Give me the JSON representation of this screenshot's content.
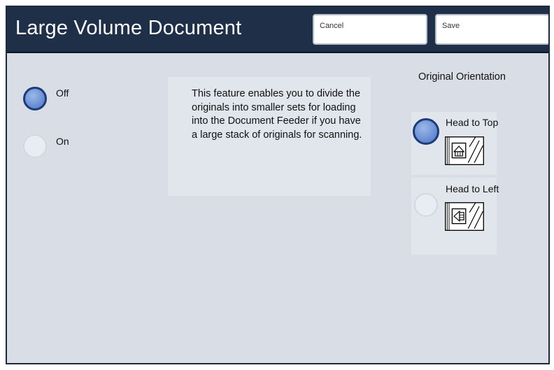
{
  "header": {
    "title": "Large Volume Document",
    "cancel_label": "Cancel",
    "save_label": "Save"
  },
  "options": [
    {
      "label": "Off",
      "selected": true
    },
    {
      "label": "On",
      "selected": false
    }
  ],
  "description": "This feature enables you to divide the originals into smaller sets for loading into the Document Feeder if you have a large stack of originals for scanning.",
  "orientation": {
    "title": "Original Orientation",
    "items": [
      {
        "label": "Head to Top",
        "selected": true,
        "icon": "head-to-top-icon"
      },
      {
        "label": "Head to Left",
        "selected": false,
        "icon": "head-to-left-icon"
      }
    ]
  },
  "colors": {
    "titlebar": "#1f2f48",
    "background": "#d9dde6",
    "radio_selected": "#6e93d6"
  }
}
